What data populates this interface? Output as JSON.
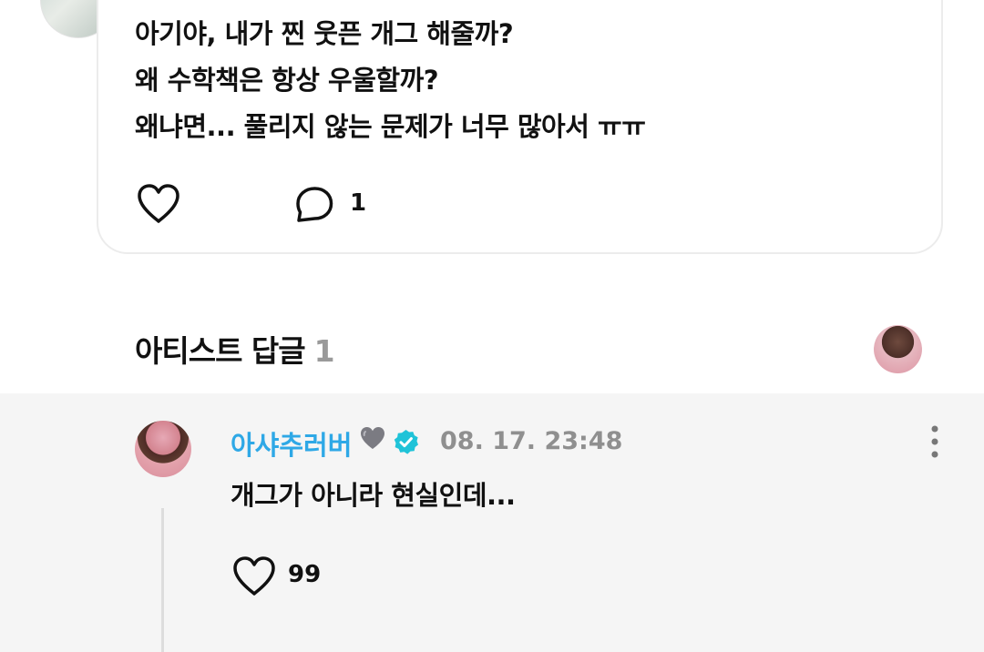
{
  "post": {
    "lines": [
      "아기야, 내가 찐 웃픈 개그 해줄까?",
      "왜 수학책은 항상 우울할까?",
      "왜냐면... 풀리지 않는 문제가 너무 많아서 ㅠㅠ"
    ],
    "comment_count": "1",
    "icons": {
      "like": "heart-outline-icon",
      "comment": "speech-bubble-icon"
    }
  },
  "artist_replies": {
    "title": "아티스트 답글",
    "count": "1"
  },
  "reply": {
    "author": "아샤추러버",
    "author_suffix_icon": "grey-heart-icon",
    "verified_icon": "verified-badge-icon",
    "time": "08. 17. 23:48",
    "text": "개그가 아니라 현실인데...",
    "like_count": "99"
  },
  "colors": {
    "accent": "#2ea8e6",
    "verified": "#1fc3d8",
    "muted_text": "#8f8f8f",
    "reply_bg": "#f5f5f5",
    "card_border": "#ececec"
  }
}
